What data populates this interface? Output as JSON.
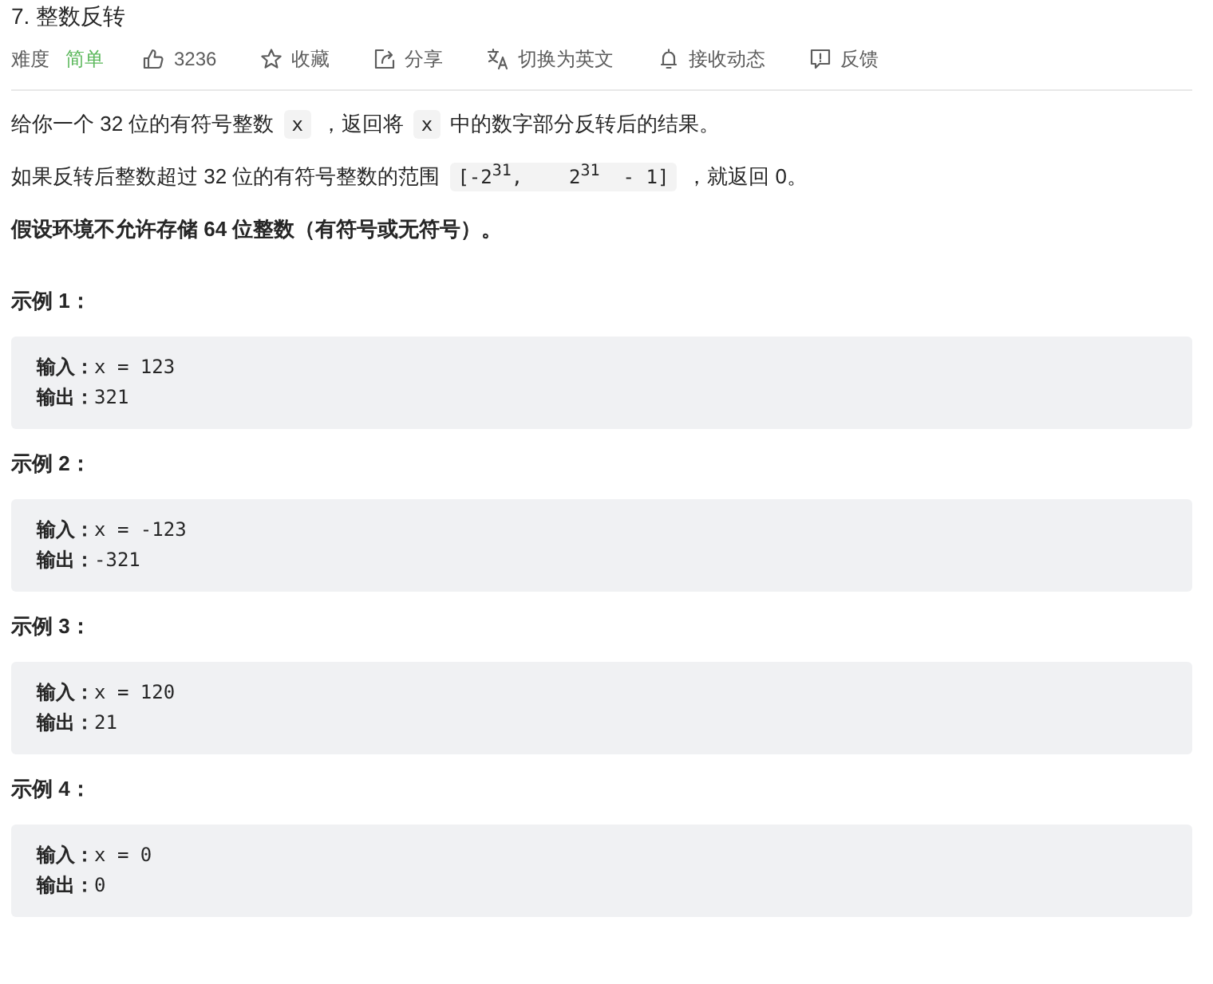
{
  "title": "7. 整数反转",
  "toolbar": {
    "difficulty_label": "难度",
    "difficulty": "简单",
    "actions": [
      {
        "kind": "like",
        "label": "3236"
      },
      {
        "kind": "favorite",
        "label": "收藏"
      },
      {
        "kind": "share",
        "label": "分享"
      },
      {
        "kind": "translate",
        "label": "切换为英文"
      },
      {
        "kind": "subscribe",
        "label": "接收动态"
      },
      {
        "kind": "feedback",
        "label": "反馈"
      }
    ]
  },
  "description": [
    {
      "bold": false,
      "segments": [
        {
          "kind": "text",
          "text": "给你一个 32 位的有符号整数"
        },
        {
          "kind": "code",
          "text": "x"
        },
        {
          "kind": "text",
          "text": "，返回将"
        },
        {
          "kind": "code",
          "text": "x"
        },
        {
          "kind": "text",
          "text": "中的数字部分反转后的结果。"
        }
      ]
    },
    {
      "bold": false,
      "segments": [
        {
          "kind": "text",
          "text": "如果反转后整数超过 32 位的有符号整数的范围"
        },
        {
          "kind": "code",
          "text": "[-2$^{31}$,    2$^{31}$  - 1]"
        },
        {
          "kind": "text",
          "text": "，就返回 0。"
        }
      ]
    },
    {
      "bold": true,
      "segments": [
        {
          "kind": "text",
          "text": "假设环境不允许存储 64 位整数（有符号或无符号）。"
        }
      ]
    }
  ],
  "examples": [
    {
      "heading": "示例 1：",
      "lines": [
        "**输入：**x = 123",
        "**输出：**321"
      ]
    },
    {
      "heading": "示例 2：",
      "lines": [
        "**输入：**x = -123",
        "**输出：**-321"
      ]
    },
    {
      "heading": "示例 3：",
      "lines": [
        "**输入：**x = 120",
        "**输出：**21"
      ]
    },
    {
      "heading": "示例 4：",
      "lines": [
        "**输入：**x = 0",
        "**输出：**0"
      ]
    }
  ]
}
